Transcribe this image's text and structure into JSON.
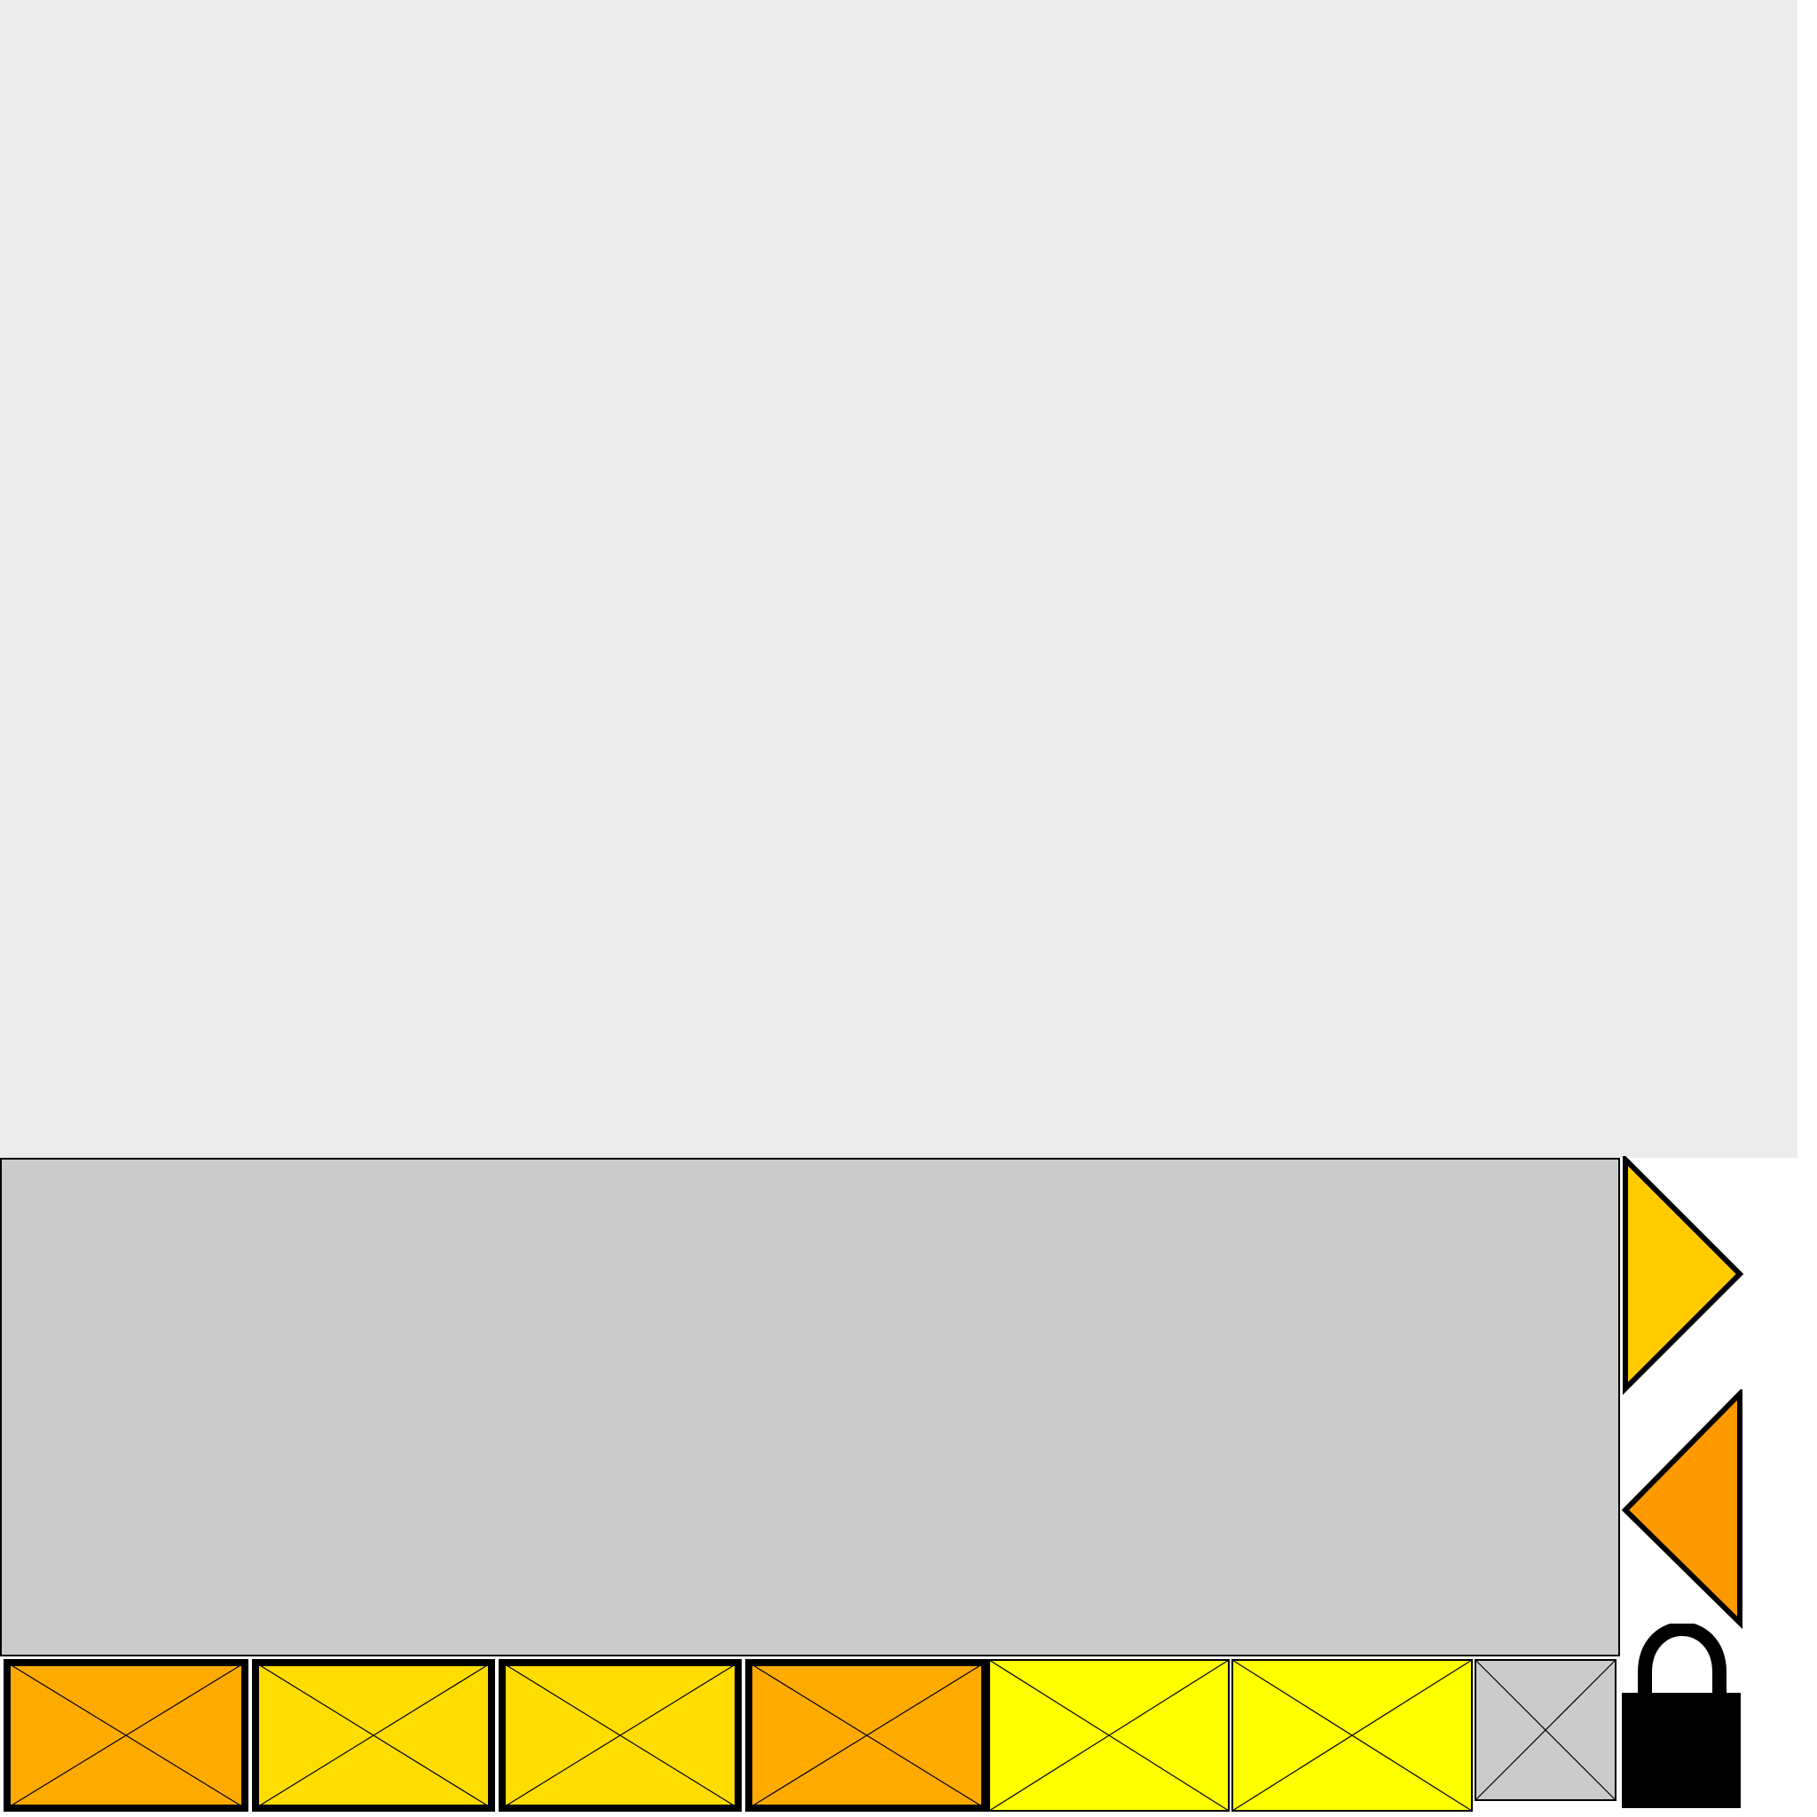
{
  "colors": {
    "top_background": "#ececec",
    "panel_background": "#cbcbcb",
    "next_button_fill": "#ffcc00",
    "previous_button_fill": "#ff9900",
    "slot_orange": "#ffaa00",
    "slot_gold": "#ffdd00",
    "slot_yellow": "#ffff00",
    "slot_empty": "#cbcbcb",
    "lock": "#000000"
  },
  "controls": {
    "next_icon": "right-triangle-icon",
    "previous_icon": "left-triangle-icon",
    "lock_icon": "lock-icon"
  },
  "slots": [
    {
      "name": "slot-1",
      "fill": "#ffaa00",
      "selected": true
    },
    {
      "name": "slot-2",
      "fill": "#ffdd00",
      "selected": true
    },
    {
      "name": "slot-3",
      "fill": "#ffdd00",
      "selected": true
    },
    {
      "name": "slot-4",
      "fill": "#ffaa00",
      "selected": true
    },
    {
      "name": "slot-5",
      "fill": "#ffff00",
      "selected": false
    },
    {
      "name": "slot-6",
      "fill": "#ffff00",
      "selected": false
    },
    {
      "name": "slot-7",
      "fill": "#cbcbcb",
      "selected": false
    }
  ]
}
